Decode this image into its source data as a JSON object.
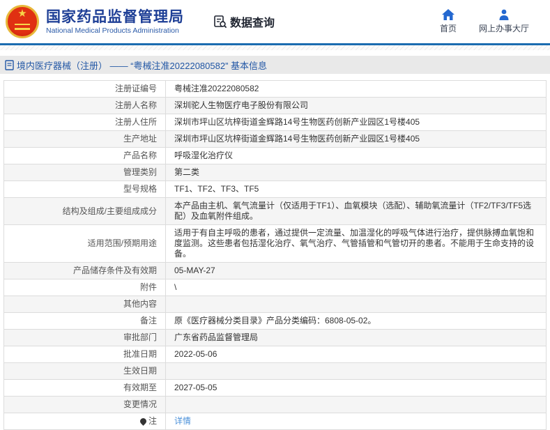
{
  "colors": {
    "brand_blue": "#1e3f96",
    "icon_blue": "#2468d0",
    "separator_blue": "#1b6cb0",
    "crumb_text_blue": "#2257a5",
    "link_blue": "#4a90d9",
    "row_stripe": "#f5f5f5",
    "emblem_red": "#de2a10",
    "emblem_gold": "#e8b83a"
  },
  "header": {
    "brand_title": "国家药品监督管理局",
    "brand_subtitle": "National Medical Products Administration",
    "section_label": "数据查询",
    "nav": {
      "home": "首页",
      "service_hall": "网上办事大厅"
    }
  },
  "breadcrumb": {
    "text": "境内医疗器械（注册） —— “粤械注准20222080582” 基本信息"
  },
  "table": {
    "rows": [
      {
        "label": "注册证编号",
        "value": "粤械注准20222080582"
      },
      {
        "label": "注册人名称",
        "value": "深圳驼人生物医疗电子股份有限公司"
      },
      {
        "label": "注册人住所",
        "value": "深圳市坪山区坑梓街道金辉路14号生物医药创新产业园区1号楼405"
      },
      {
        "label": "生产地址",
        "value": "深圳市坪山区坑梓街道金辉路14号生物医药创新产业园区1号楼405"
      },
      {
        "label": "产品名称",
        "value": "呼吸湿化治疗仪"
      },
      {
        "label": "管理类别",
        "value": "第二类"
      },
      {
        "label": "型号规格",
        "value": "TF1、TF2、TF3、TF5"
      },
      {
        "label": "结构及组成/主要组成成分",
        "value": "本产品由主机、氧气流量计（仅适用于TF1）、血氧模块（选配）、辅助氧流量计（TF2/TF3/TF5选配）及血氧附件组成。"
      },
      {
        "label": "适用范围/预期用途",
        "value": "适用于有自主呼吸的患者，通过提供一定流量、加温湿化的呼吸气体进行治疗，提供脉搏血氧饱和度监测。这些患者包括湿化治疗、氧气治疗、气管插管和气管切开的患者。不能用于生命支持的设备。"
      },
      {
        "label": "产品储存条件及有效期",
        "value": "05-MAY-27"
      },
      {
        "label": "附件",
        "value": "\\"
      },
      {
        "label": "其他内容",
        "value": ""
      },
      {
        "label": "备注",
        "value": "原《医疗器械分类目录》产品分类编码：6808-05-02。"
      },
      {
        "label": "审批部门",
        "value": "广东省药品监督管理局"
      },
      {
        "label": "批准日期",
        "value": "2022-05-06"
      },
      {
        "label": "生效日期",
        "value": ""
      },
      {
        "label": "有效期至",
        "value": "2027-05-05"
      },
      {
        "label": "变更情况",
        "value": ""
      },
      {
        "label": "注",
        "value": "详情",
        "link": true,
        "icon": "note"
      }
    ]
  }
}
